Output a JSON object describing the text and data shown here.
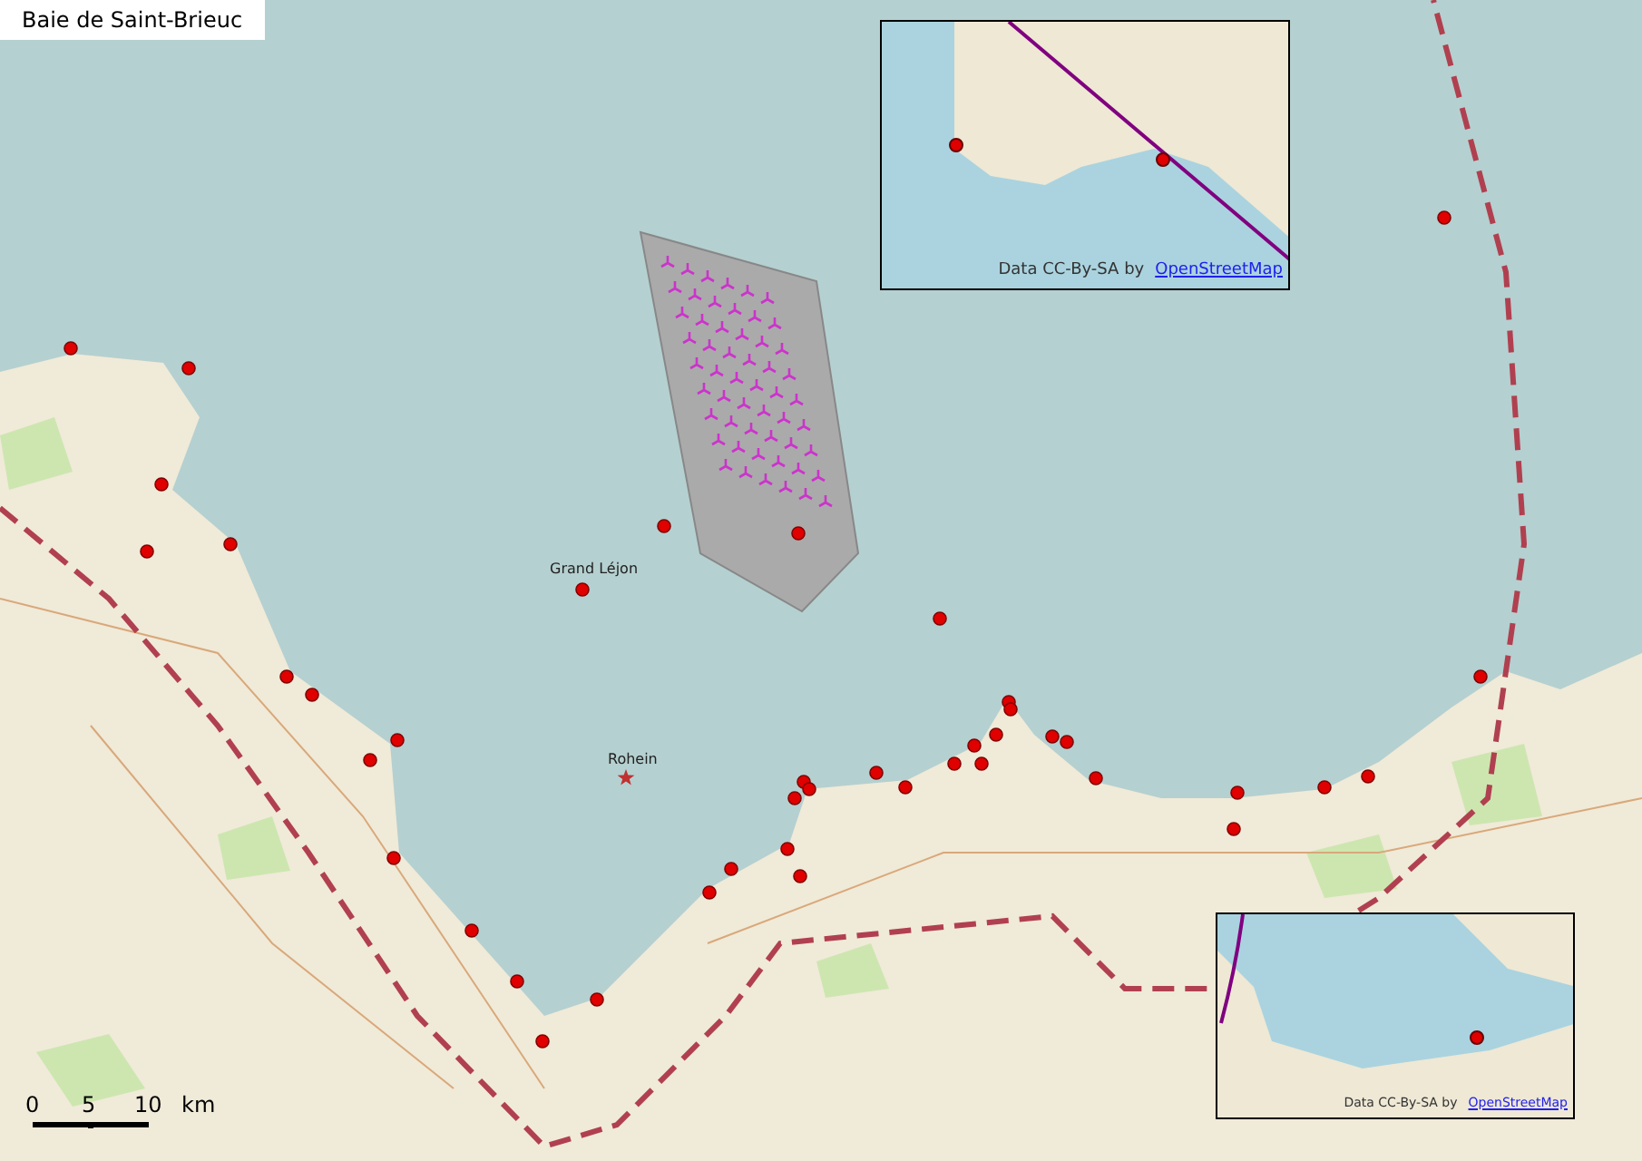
{
  "title": "Baie de Saint-Brieuc",
  "place_labels": [
    {
      "name": "Grand Léjon"
    },
    {
      "name": "Rohein"
    }
  ],
  "scale_bar": {
    "ticks": [
      "0",
      "5",
      "10"
    ],
    "unit": "km"
  },
  "insets": [
    {
      "attribution": "Data CC-By-SA by",
      "link": "OpenStreetMap"
    },
    {
      "attribution": "Data CC-By-SA by",
      "link": "OpenStreetMap"
    }
  ]
}
